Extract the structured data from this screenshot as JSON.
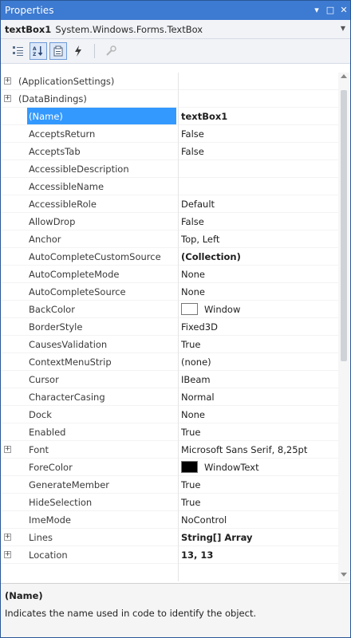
{
  "window": {
    "title": "Properties",
    "pin_glyph": "▾",
    "maximize_glyph": "□",
    "close_glyph": "✕"
  },
  "object_selector": {
    "name": "textBox1",
    "type": "System.Windows.Forms.TextBox"
  },
  "toolbar": {
    "buttons": [
      {
        "icon": "categorized-icon",
        "active": false
      },
      {
        "icon": "alphabetical-icon",
        "active": true
      },
      {
        "icon": "properties-icon",
        "active": true
      },
      {
        "icon": "events-icon",
        "active": false
      },
      {
        "icon": "property-pages-icon",
        "active": false
      }
    ]
  },
  "grid": {
    "rows": [
      {
        "name": "(ApplicationSettings)",
        "value": "",
        "expandable": true,
        "category": true
      },
      {
        "name": "(DataBindings)",
        "value": "",
        "expandable": true,
        "category": true
      },
      {
        "name": "(Name)",
        "value": "textBox1",
        "bold": true,
        "selected": true
      },
      {
        "name": "AcceptsReturn",
        "value": "False"
      },
      {
        "name": "AcceptsTab",
        "value": "False"
      },
      {
        "name": "AccessibleDescription",
        "value": ""
      },
      {
        "name": "AccessibleName",
        "value": ""
      },
      {
        "name": "AccessibleRole",
        "value": "Default"
      },
      {
        "name": "AllowDrop",
        "value": "False"
      },
      {
        "name": "Anchor",
        "value": "Top, Left"
      },
      {
        "name": "AutoCompleteCustomSource",
        "value": "(Collection)",
        "bold": true
      },
      {
        "name": "AutoCompleteMode",
        "value": "None"
      },
      {
        "name": "AutoCompleteSource",
        "value": "None"
      },
      {
        "name": "BackColor",
        "value": "Window",
        "swatch": "#ffffff"
      },
      {
        "name": "BorderStyle",
        "value": "Fixed3D"
      },
      {
        "name": "CausesValidation",
        "value": "True"
      },
      {
        "name": "ContextMenuStrip",
        "value": "(none)"
      },
      {
        "name": "Cursor",
        "value": "IBeam"
      },
      {
        "name": "CharacterCasing",
        "value": "Normal"
      },
      {
        "name": "Dock",
        "value": "None"
      },
      {
        "name": "Enabled",
        "value": "True"
      },
      {
        "name": "Font",
        "value": "Microsoft Sans Serif, 8,25pt",
        "expandable": true
      },
      {
        "name": "ForeColor",
        "value": "WindowText",
        "swatch": "#000000"
      },
      {
        "name": "GenerateMember",
        "value": "True"
      },
      {
        "name": "HideSelection",
        "value": "True"
      },
      {
        "name": "ImeMode",
        "value": "NoControl"
      },
      {
        "name": "Lines",
        "value": "String[] Array",
        "bold": true,
        "expandable": true
      },
      {
        "name": "Location",
        "value": "13, 13",
        "bold": true,
        "expandable": true
      }
    ]
  },
  "help": {
    "title": "(Name)",
    "description": "Indicates the name used in code to identify the object."
  },
  "colors": {
    "titlebar": "#3d7ad1",
    "selection": "#3399ff"
  }
}
